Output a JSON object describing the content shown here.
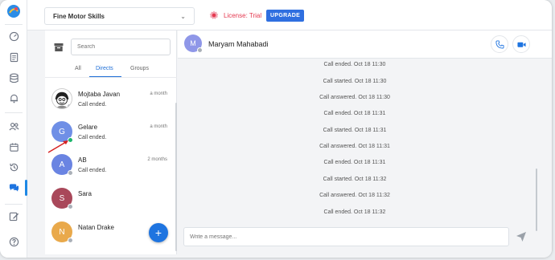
{
  "colors": {
    "accent": "#1e74e0",
    "license": "#e53950",
    "upgrade": "#2f6fe0"
  },
  "sidebar": {
    "items": [
      {
        "icon": "dashboard-icon"
      },
      {
        "icon": "document-icon"
      },
      {
        "icon": "database-icon"
      },
      {
        "icon": "bell-icon"
      },
      {
        "icon": "users-icon"
      },
      {
        "icon": "calendar-icon"
      },
      {
        "icon": "history-icon"
      },
      {
        "icon": "chat-icon",
        "active": true
      },
      {
        "icon": "edit-icon"
      },
      {
        "icon": "help-icon"
      }
    ]
  },
  "header": {
    "course": "Fine Motor Skills",
    "license": "License: Trial",
    "upgrade": "UPGRADE"
  },
  "list": {
    "search_placeholder": "Search",
    "tabs": [
      "All",
      "Directs",
      "Groups"
    ],
    "active_tab": "Directs",
    "conversations": [
      {
        "name": "Mojtaba Javan",
        "time": "a month",
        "last": "Call ended.",
        "initial": "",
        "color": "#ffffff",
        "status": "offline"
      },
      {
        "name": "Gelare",
        "time": "a month",
        "last": "Call ended.",
        "initial": "G",
        "color": "#6f8fe6",
        "status": "online"
      },
      {
        "name": "AB",
        "time": "2 months",
        "last": "Call ended.",
        "initial": "A",
        "color": "#6a84e2",
        "status": "offline"
      },
      {
        "name": "Sara",
        "time": "",
        "last": "",
        "initial": "S",
        "color": "#a9485a",
        "status": "offline"
      },
      {
        "name": "Natan Drake",
        "time": "",
        "last": "",
        "initial": "N",
        "color": "#e9a94b",
        "status": "offline"
      }
    ]
  },
  "chat": {
    "contact": {
      "name": "Maryam Mahabadi",
      "initial": "M",
      "color": "#8f97e8"
    },
    "messages": [
      "Call ended. Oct 18 11:30",
      "Call started. Oct 18 11:30",
      "Call answered. Oct 18 11:30",
      "Call ended. Oct 18 11:31",
      "Call started. Oct 18 11:31",
      "Call answered. Oct 18 11:31",
      "Call ended. Oct 18 11:31",
      "Call started. Oct 18 11:32",
      "Call answered. Oct 18 11:32",
      "Call ended. Oct 18 11:32"
    ],
    "composer_placeholder": "Write a message..."
  }
}
